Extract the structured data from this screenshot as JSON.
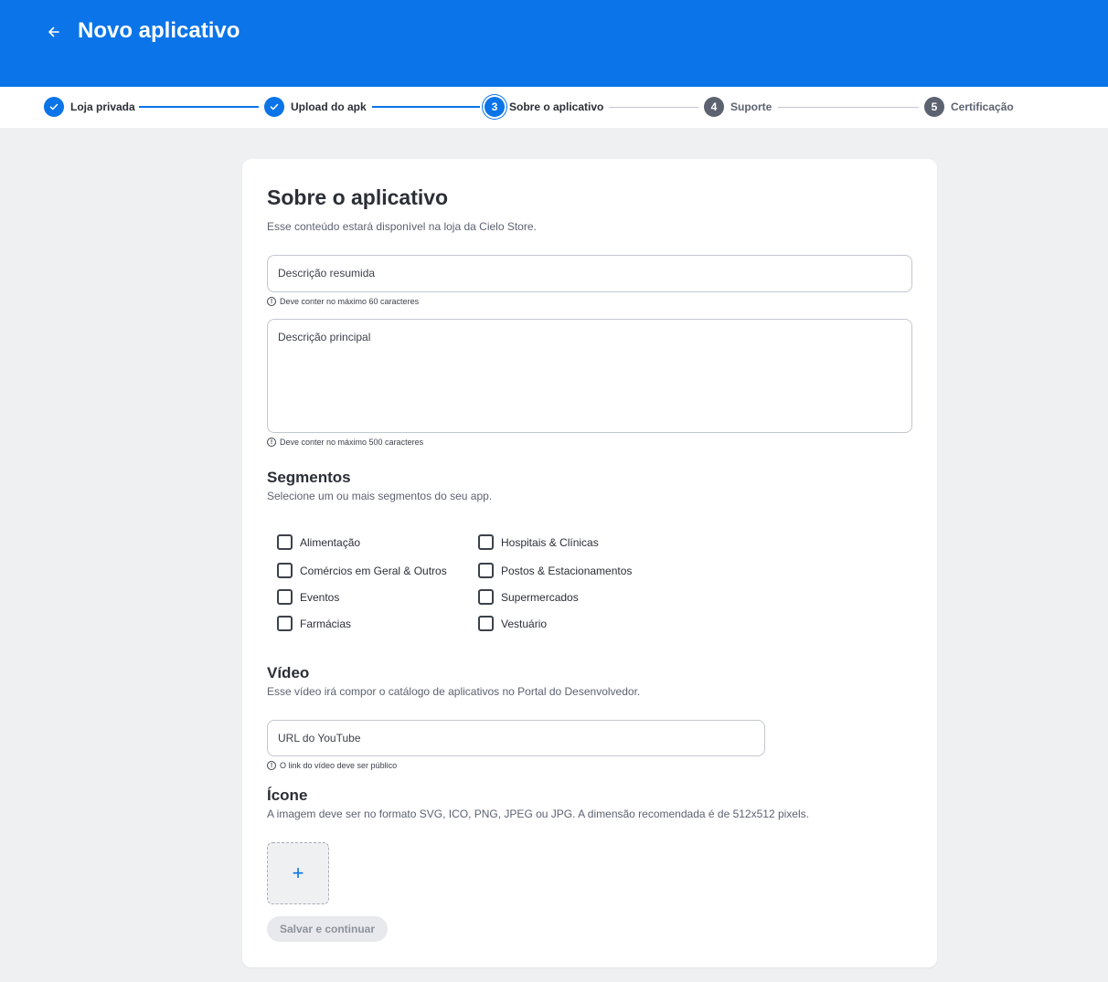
{
  "header": {
    "title": "Novo aplicativo",
    "back_icon": "arrow-left-icon",
    "color": "#0a74e8"
  },
  "stepper": {
    "steps": [
      {
        "number": "1",
        "label": "Loja privada",
        "state": "done"
      },
      {
        "number": "2",
        "label": "Upload do apk",
        "state": "done"
      },
      {
        "number": "3",
        "label": "Sobre o aplicativo",
        "state": "current"
      },
      {
        "number": "4",
        "label": "Suporte",
        "state": "todo"
      },
      {
        "number": "5",
        "label": "Certificação",
        "state": "todo"
      }
    ]
  },
  "form": {
    "title": "Sobre o aplicativo",
    "subtitle": "Esse conteúdo estará disponível na loja da Cielo Store.",
    "short_description": {
      "label": "Descrição resumida",
      "value": "",
      "hint": "Deve conter no máximo 60 caracteres"
    },
    "main_description": {
      "label": "Descrição principal",
      "value": "",
      "hint": "Deve conter no máximo 500 caracteres"
    },
    "segments": {
      "title": "Segmentos",
      "description": "Selecione um ou mais segmentos do seu app.",
      "options": [
        {
          "label": "Alimentação",
          "checked": false
        },
        {
          "label": "Comércios em Geral & Outros",
          "checked": false
        },
        {
          "label": "Eventos",
          "checked": false
        },
        {
          "label": "Farmácias",
          "checked": false
        },
        {
          "label": "Hospitais & Clínicas",
          "checked": false
        },
        {
          "label": "Postos & Estacionamentos",
          "checked": false
        },
        {
          "label": "Supermercados",
          "checked": false
        },
        {
          "label": "Vestuário",
          "checked": false
        }
      ]
    },
    "video": {
      "title": "Vídeo",
      "description": "Esse vídeo irá compor o catálogo de aplicativos no Portal do Desenvolvedor.",
      "label": "URL do YouTube",
      "value": "",
      "hint": "O link do vídeo deve ser público"
    },
    "icon": {
      "title": "Ícone",
      "description": "A imagem deve ser no formato SVG, ICO, PNG, JPEG ou JPG. A dimensão recomendada é de 512x512 pixels.",
      "upload_icon": "plus-icon"
    },
    "save_label": "Salvar e continuar"
  }
}
